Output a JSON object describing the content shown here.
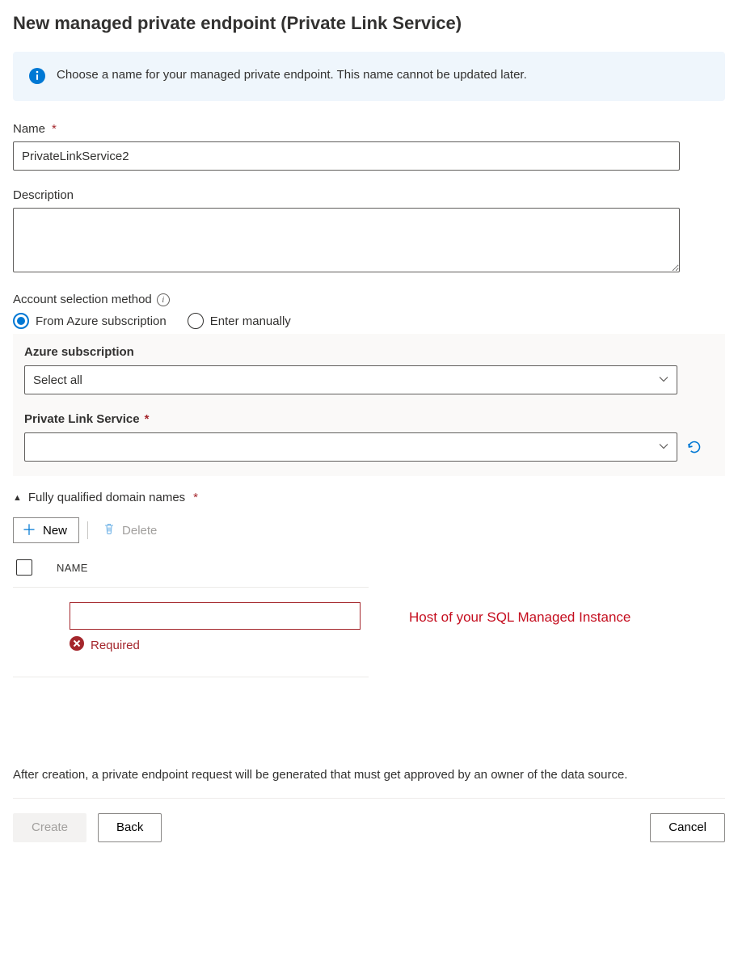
{
  "title": "New managed private endpoint (Private Link Service)",
  "info_message": "Choose a name for your managed private endpoint. This name cannot be updated later.",
  "fields": {
    "name": {
      "label": "Name",
      "value": "PrivateLinkService2"
    },
    "description": {
      "label": "Description",
      "value": ""
    },
    "account_method": {
      "label": "Account selection method",
      "options": {
        "from_sub": "From Azure subscription",
        "manual": "Enter manually"
      },
      "selected": "from_sub"
    },
    "azure_sub": {
      "label": "Azure subscription",
      "selected": "Select all"
    },
    "pls": {
      "label": "Private Link Service",
      "selected": ""
    }
  },
  "fqdn": {
    "header": "Fully qualified domain names",
    "buttons": {
      "new": "New",
      "delete": "Delete"
    },
    "column": "NAME",
    "row_value": "",
    "error": "Required",
    "annotation": "Host of your SQL Managed Instance"
  },
  "footer_note": "After creation, a private endpoint request will be generated that must get approved by an owner of the data source.",
  "actions": {
    "create": "Create",
    "back": "Back",
    "cancel": "Cancel"
  }
}
